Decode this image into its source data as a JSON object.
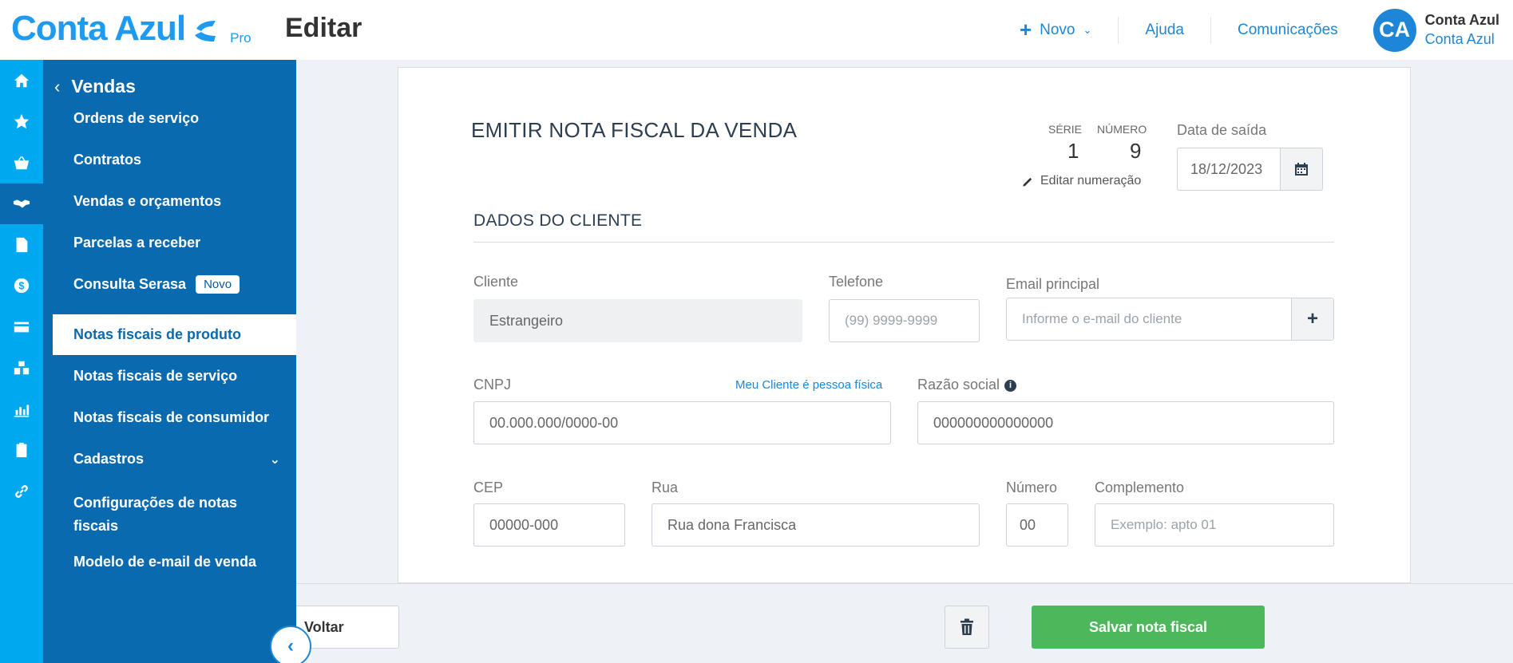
{
  "header": {
    "logo_text": "Conta Azul",
    "logo_tier": "Pro",
    "page_title": "Editar",
    "new_label": "Novo",
    "help_label": "Ajuda",
    "communications_label": "Comunicações",
    "user": {
      "initials": "CA",
      "name": "Conta Azul",
      "org": "Conta Azul"
    },
    "brand_color": "#1e9bf0"
  },
  "rail": {
    "icons": [
      "home-icon",
      "star-icon",
      "basket-icon",
      "handshake-icon",
      "document-icon",
      "dollar-icon",
      "card-icon",
      "boxes-icon",
      "chart-icon",
      "clipboard-icon",
      "link-icon"
    ],
    "active_index": 3
  },
  "sidebar": {
    "title": "Vendas",
    "items": [
      {
        "label": "Ordens de serviço"
      },
      {
        "label": "Contratos"
      },
      {
        "label": "Vendas e orçamentos"
      },
      {
        "label": "Parcelas a receber"
      },
      {
        "label": "Consulta Serasa",
        "badge": "Novo"
      },
      {
        "label": "Notas fiscais de produto",
        "active": true
      },
      {
        "label": "Notas fiscais de serviço"
      },
      {
        "label": "Notas fiscais de consumidor"
      },
      {
        "label": "Cadastros"
      },
      {
        "label_line1": "Configurações de notas",
        "label_line2": "fiscais"
      },
      {
        "label": "Modelo de e-mail de venda"
      }
    ]
  },
  "form": {
    "title": "EMITIR NOTA FISCAL DA VENDA",
    "serie_label": "SÉRIE",
    "serie_value": "1",
    "numero_label": "NÚMERO",
    "numero_value": "9",
    "edit_numbering": "Editar numeração",
    "data_saida_label": "Data de saída",
    "data_saida_value": "18/12/2023",
    "client_section": "DADOS DO CLIENTE",
    "cliente_label": "Cliente",
    "cliente_value": "Estrangeiro",
    "telefone_label": "Telefone",
    "telefone_placeholder": "(99) 9999-9999",
    "email_label": "Email principal",
    "email_placeholder": "Informe o e-mail do cliente",
    "cnpj_label": "CNPJ",
    "pessoa_fisica_link": "Meu Cliente é pessoa física",
    "cnpj_value": "00.000.000/0000-00",
    "razao_label": "Razão social",
    "razao_value": "000000000000000",
    "cep_label": "CEP",
    "cep_value": "00000-000",
    "rua_label": "Rua",
    "rua_value": "Rua dona Francisca",
    "numero_end_label": "Número",
    "numero_end_value": "00",
    "complemento_label": "Complemento",
    "complemento_placeholder": "Exemplo: apto 01"
  },
  "footer": {
    "back_label": "Voltar",
    "save_label": "Salvar nota fiscal",
    "save_color": "#4cb75b"
  }
}
